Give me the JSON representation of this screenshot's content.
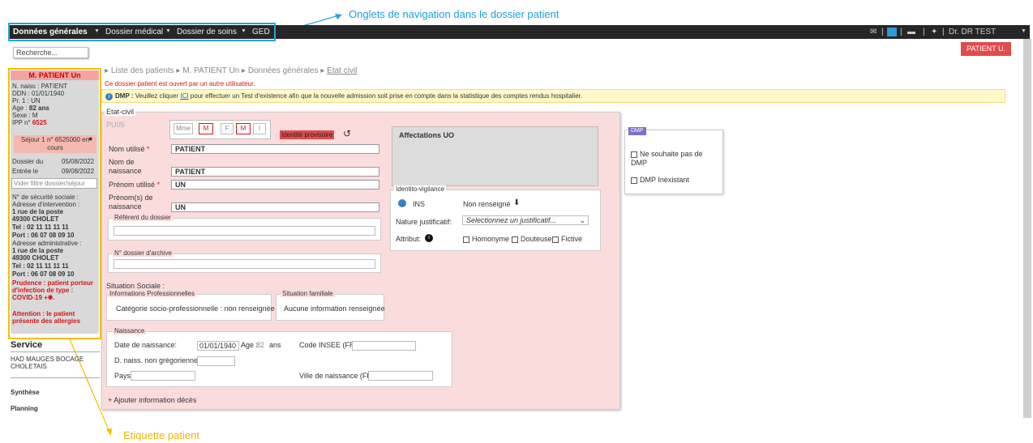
{
  "annotations": {
    "nav": "Onglets de navigation dans le dossier patient",
    "label": "Etiquette patient"
  },
  "nav": {
    "tabs": [
      "Données générales",
      "Dossier médical",
      "Dossier de soins",
      "GED"
    ],
    "user": "Dr. DR TEST"
  },
  "patient_button": "PATIENT U.",
  "search": {
    "placeholder": "Recherche..."
  },
  "label": {
    "name": "M. PATIENT Un",
    "lines": [
      "N. naiss : PATIENT",
      "DDN : 01/01/1940",
      "Pr. 1 : UN"
    ],
    "age_prefix": "Age : ",
    "age": "82 ans",
    "sexe": "Sexe : M",
    "ipp_prefix": "IPP n° ",
    "ipp": "6525",
    "sejour": "Séjour 1 n° 6525000 en cours",
    "dossier_du_label": "Dossier du",
    "dossier_du": "05/08/2022",
    "entree_le_label": "Entrée le",
    "entree_le": "09/08/2022",
    "filtre": "Vider filtre dossier/séjour",
    "secu": "N° de sécurité sociale :",
    "adr_interv": "Adresse d'intervention :",
    "adr1": "1 rue de la poste",
    "ville1": "49300 CHOLET",
    "tel1": "Tel : 02 11 11 11 11",
    "port1": "Port : 06 07 08 09 10",
    "adr_admin": "Adresse administrative :",
    "adr2": "1 rue de la poste",
    "ville2": "49300 CHOLET",
    "tel2": "Tel : 02 11 11 11 11",
    "port2": "Port : 06 07 08 09 10",
    "prudence": "Prudence : patient porteur d'infection de type : COVID-19 +",
    "attention": "Attention : le patient présente des allergies"
  },
  "service": {
    "title": "Service",
    "name": "HAD MAUGES BOCAGE CHOLETAIS",
    "links": [
      "Synthèse",
      "Planning"
    ]
  },
  "breadcrumb": [
    "Liste des patients",
    "M. PATIENT Un",
    "Données générales",
    "Etat civil"
  ],
  "warning_open": "Ce dossier patient est ouvert par un autre utilisateur.",
  "dmp_bar": {
    "bold": "DMP :",
    "pre": " Veuillez cliquer ",
    "link": "ICI",
    "post": " pour effectuer un Test d'existence afin que la nouvelle admission soit prise en compte dans la statistique des comptes rendus hospitalier."
  },
  "etat_civil": {
    "legend": "Etat-civil",
    "code": "PU05",
    "civilite": [
      "Mme",
      "M",
      "F",
      "M",
      "I"
    ],
    "identite_provisoire": "Identité provisoire",
    "nom_utilise_label": "Nom utilisé",
    "nom_utilise": "PATIENT",
    "nom_naissance_label": "Nom de naissance",
    "nom_naissance": "PATIENT",
    "prenom_utilise_label": "Prénom utilisé",
    "prenom_utilise": "UN",
    "prenoms_naissance_label": "Prénom(s) de naissance",
    "prenoms_naissance": "UN",
    "referent_legend": "Référent du dossier",
    "archive_legend": "N° dossier d'archive",
    "situation_sociale": "Situation Sociale :",
    "info_pro_legend": "Informations Professionnelles",
    "info_pro": "Catégorie socio-professionnelle : non renseignée",
    "sit_fam_legend": "Situation familiale",
    "sit_fam": "Aucune information renseignée",
    "naissance_legend": "Naissance",
    "date_naissance_label": "Date de naissance:",
    "date_naissance": "01/01/1940",
    "age_label": "Age :",
    "age": "82",
    "age_unit": "ans",
    "insee_label": "Code INSEE (FR)",
    "non_greg_label": "D. naiss. non grégorienne :",
    "pays_label": "Pays",
    "ville_label": "Ville de naissance (FR)",
    "deces_link": "+ Ajouter information décès"
  },
  "affectations": {
    "title": "Affectations UO"
  },
  "identito": {
    "legend": "Identito-vigilance",
    "ins_label": "INS",
    "ins_value": "Non renseigné",
    "nature_label": "Nature justificatif:",
    "nature_placeholder": "Selectionnez un justificatif...",
    "attribut_label": "Attribut:",
    "attributs": [
      "Homonyme",
      "Douteuse",
      "Fictive"
    ]
  },
  "dmp_panel": {
    "legend": "DMP",
    "opt1": "Ne souhaite pas de DMP",
    "opt2": "DMP Inexistant"
  }
}
